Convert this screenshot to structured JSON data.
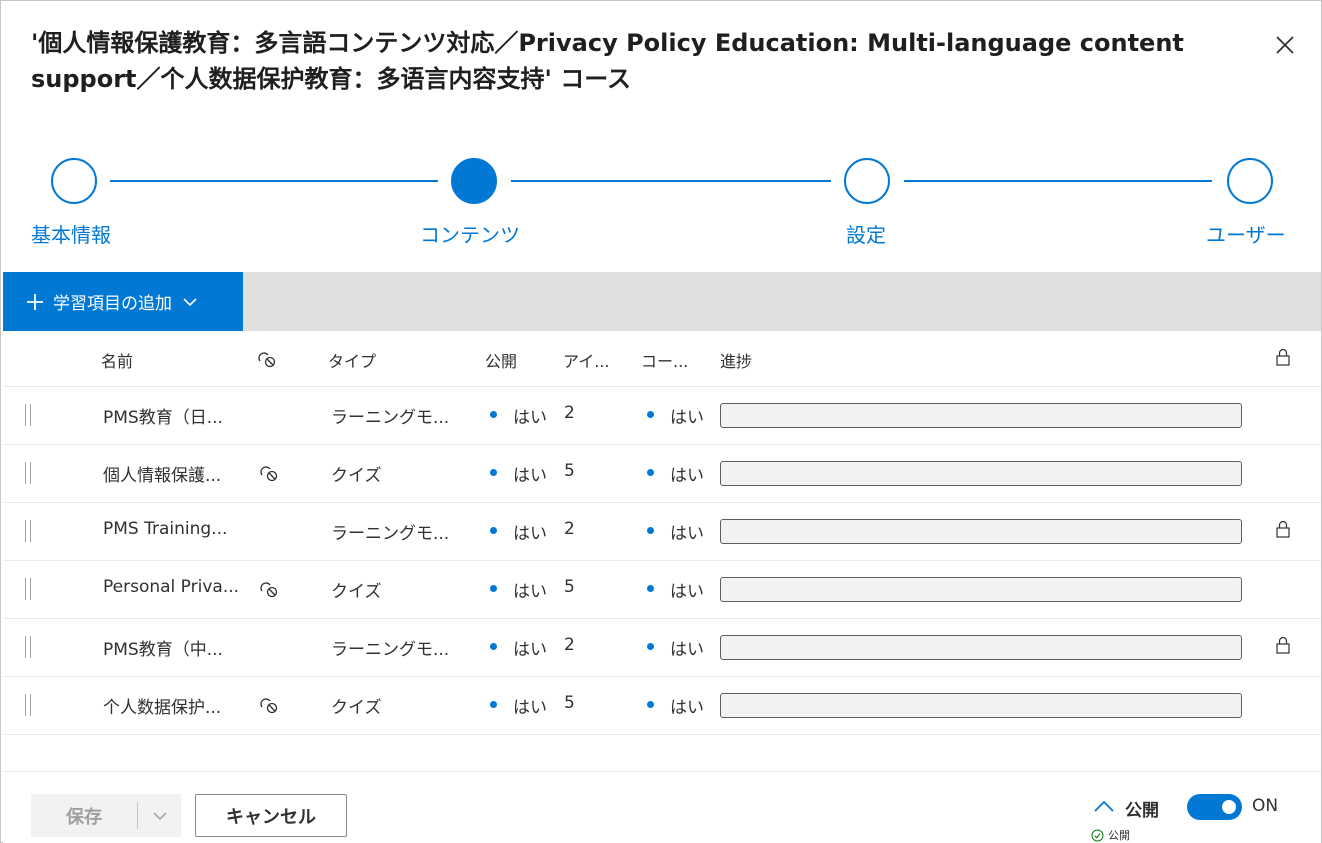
{
  "dialog": {
    "title": "'個人情報保護教育：多言語コンテンツ対応／Privacy Policy Education: Multi-language content support／个人数据保护教育：多语言内容支持' コース"
  },
  "stepper": {
    "steps": [
      {
        "label": "基本情報",
        "active": false
      },
      {
        "label": "コンテンツ",
        "active": true
      },
      {
        "label": "設定",
        "active": false
      },
      {
        "label": "ユーザー",
        "active": false
      }
    ]
  },
  "toolbar": {
    "add_label": "学習項目の追加",
    "add_icon": "plus-icon",
    "dropdown_icon": "chevron-down-icon"
  },
  "table": {
    "headers": {
      "name": "名前",
      "link_icon": "link-icon",
      "type": "タイプ",
      "published": "公開",
      "items": "アイ...",
      "completion": "コー...",
      "progress": "進捗",
      "lock_icon": "lock-icon"
    },
    "rows": [
      {
        "name": "PMS教育（日...",
        "linked": false,
        "type": "ラーニングモ...",
        "published": "はい",
        "items": "2",
        "completion": "はい",
        "progress": 0,
        "locked": false
      },
      {
        "name": "個人情報保護...",
        "linked": true,
        "type": "クイズ",
        "published": "はい",
        "items": "5",
        "completion": "はい",
        "progress": 0,
        "locked": false
      },
      {
        "name": "PMS Training...",
        "linked": false,
        "type": "ラーニングモ...",
        "published": "はい",
        "items": "2",
        "completion": "はい",
        "progress": 0,
        "locked": true
      },
      {
        "name": "Personal Priva...",
        "linked": true,
        "type": "クイズ",
        "published": "はい",
        "items": "5",
        "completion": "はい",
        "progress": 0,
        "locked": false
      },
      {
        "name": "PMS教育（中...",
        "linked": false,
        "type": "ラーニングモ...",
        "published": "はい",
        "items": "2",
        "completion": "はい",
        "progress": 0,
        "locked": true
      },
      {
        "name": "个人数据保护...",
        "linked": true,
        "type": "クイズ",
        "published": "はい",
        "items": "5",
        "completion": "はい",
        "progress": 0,
        "locked": false
      }
    ]
  },
  "footer": {
    "save_label": "保存",
    "cancel_label": "キャンセル",
    "publish_label": "公開",
    "toggle_label": "ON",
    "toggle_on": true,
    "status_small": "公開"
  },
  "colors": {
    "accent": "#0078d4",
    "toolbar_bg": "#e1dfdd"
  }
}
